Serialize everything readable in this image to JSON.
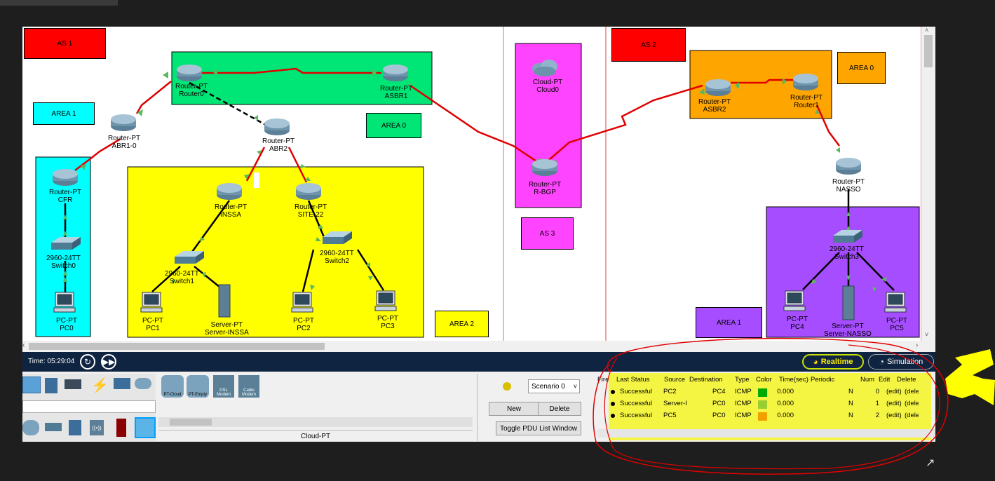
{
  "workspace": {
    "areas": {
      "as1": "AS 1",
      "as2": "AS 2",
      "as3": "AS 3",
      "area1_left": "AREA 1",
      "area0_left": "AREA 0",
      "area2": "AREA 2",
      "area0_right": "AREA 0",
      "area1_right": "AREA 1"
    },
    "devices": {
      "router0": [
        "Router-PT",
        "Router0"
      ],
      "asbr1": [
        "Router-PT",
        "ASBR1"
      ],
      "abr1_0": [
        "Router-PT",
        "ABR1-0"
      ],
      "abr2": [
        "Router-PT",
        "ABR2"
      ],
      "cfr": [
        "Router-PT",
        "CFR"
      ],
      "switch0": [
        "2960-24TT",
        "Switch0"
      ],
      "pc0": [
        "PC-PT",
        "PC0"
      ],
      "insaa": [
        "Router-PT",
        "INSSA"
      ],
      "site22": [
        "Router-PT",
        "SITE-22"
      ],
      "switch1": [
        "2960-24TT",
        "Switch1"
      ],
      "switch2": [
        "2960-24TT",
        "Switch2"
      ],
      "pc1": [
        "PC-PT",
        "PC1"
      ],
      "server_inssa": [
        "Server-PT",
        "Server-INSSA"
      ],
      "pc2": [
        "PC-PT",
        "PC2"
      ],
      "pc3": [
        "PC-PT",
        "PC3"
      ],
      "cloud0": [
        "Cloud-PT",
        "Cloud0"
      ],
      "rbgp": [
        "Router-PT",
        "R-BGP"
      ],
      "asbr2": [
        "Router-PT",
        "ASBR2"
      ],
      "router1": [
        "Router-PT",
        "Router1"
      ],
      "nasso": [
        "Router-PT",
        "NASSO"
      ],
      "switch3": [
        "2960-24TT",
        "Switch3"
      ],
      "pc4": [
        "PC-PT",
        "PC4"
      ],
      "server_nasso": [
        "Server-PT",
        "Server-NASSO"
      ],
      "pc5": [
        "PC-PT",
        "PC5"
      ]
    },
    "colors": {
      "as_red": "#ff0000",
      "area0_green": "#00e676",
      "area1_cyan": "#00ffff",
      "area2_yellow": "#ffff00",
      "as3_magenta": "#ff44ff",
      "area0_orange": "#ffa500",
      "area1_purple": "#a64dff",
      "link_red": "#e00000"
    }
  },
  "timebar": {
    "time_label": "Time: 05:29:04",
    "realtime_label": "Realtime",
    "simulation_label": "Simulation"
  },
  "device_panel": {
    "type_icons": [
      "PT-Cloud",
      "PT-Empty",
      "DSL Modem",
      "Cable Modem"
    ],
    "selected_device": "Cloud-PT"
  },
  "scenario": {
    "selected": "Scenario 0",
    "new_label": "New",
    "delete_label": "Delete",
    "toggle_label": "Toggle PDU List Window"
  },
  "pdu_list": {
    "headers": [
      "Fire",
      "Last Status",
      "Source",
      "Destination",
      "Type",
      "Color",
      "Time(sec)",
      "Periodic",
      "Num",
      "Edit",
      "Delete"
    ],
    "rows": [
      {
        "status": "Successful",
        "source": "PC2",
        "destination": "PC4",
        "type": "ICMP",
        "color": "#00aa00",
        "time": "0.000",
        "periodic": "N",
        "num": "0",
        "edit": "(edit)",
        "delete": "(delete)"
      },
      {
        "status": "Successful",
        "source": "Server-I",
        "destination": "PC0",
        "type": "ICMP",
        "color": "#9acd32",
        "time": "0.000",
        "periodic": "N",
        "num": "1",
        "edit": "(edit)",
        "delete": "(delete)"
      },
      {
        "status": "Successful",
        "source": "PC5",
        "destination": "PC0",
        "type": "ICMP",
        "color": "#f0a000",
        "time": "0.000",
        "periodic": "N",
        "num": "2",
        "edit": "(edit)",
        "delete": "(delete)"
      }
    ]
  }
}
